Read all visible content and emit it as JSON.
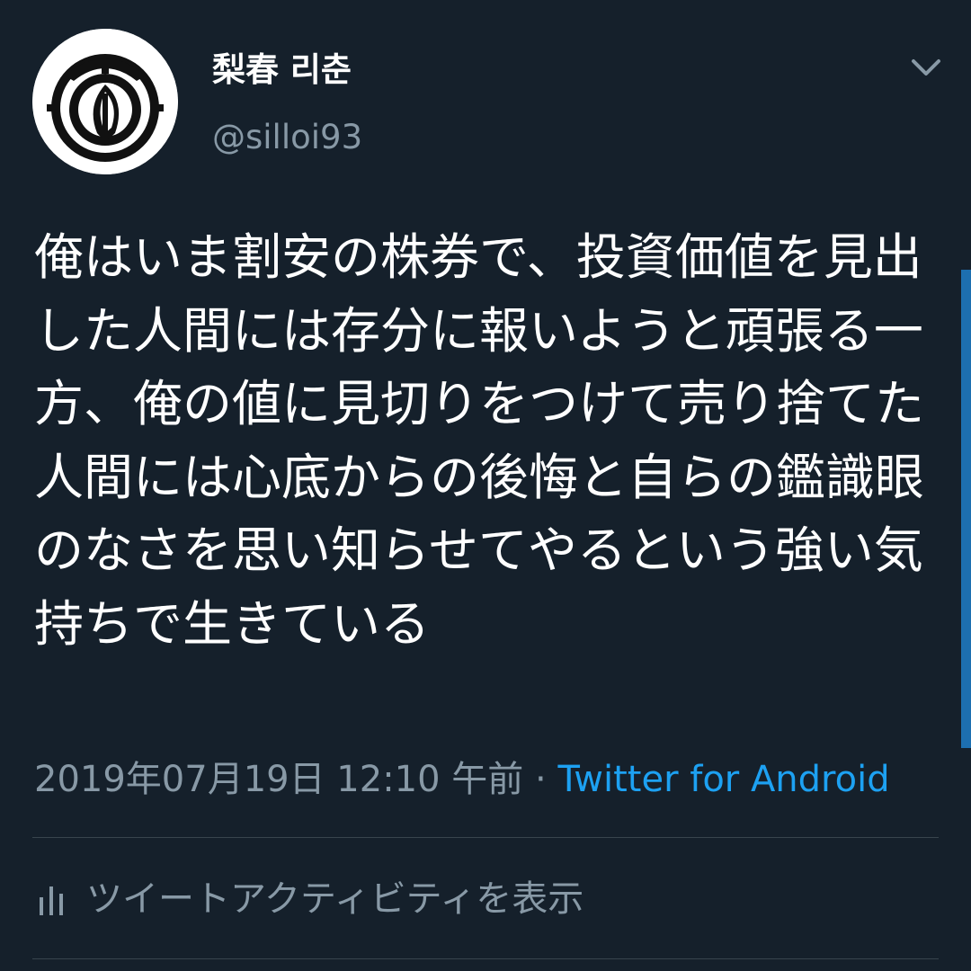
{
  "user": {
    "display_name": "梨春 리춘",
    "handle": "@silloi93"
  },
  "tweet": {
    "text": "俺はいま割安の株券で、投資価値を見出した人間には存分に報いようと頑張る一方、俺の値に見切りをつけて売り捨てた人間には心底からの後悔と自らの鑑識眼のなさを思い知らせてやるという強い気持ちで生きている",
    "timestamp": "2019年07月19日 12:10 午前",
    "separator": " · ",
    "source": "Twitter for Android"
  },
  "actions": {
    "activity_label": "ツイートアクティビティを表示"
  },
  "icons": {
    "avatar": "logo-avatar",
    "menu": "chevron-down-icon",
    "activity": "bar-chart-icon"
  },
  "colors": {
    "background": "#15202b",
    "text": "#ffffff",
    "secondary": "#8899a6",
    "link": "#1da1f2",
    "divider": "#38444d"
  }
}
